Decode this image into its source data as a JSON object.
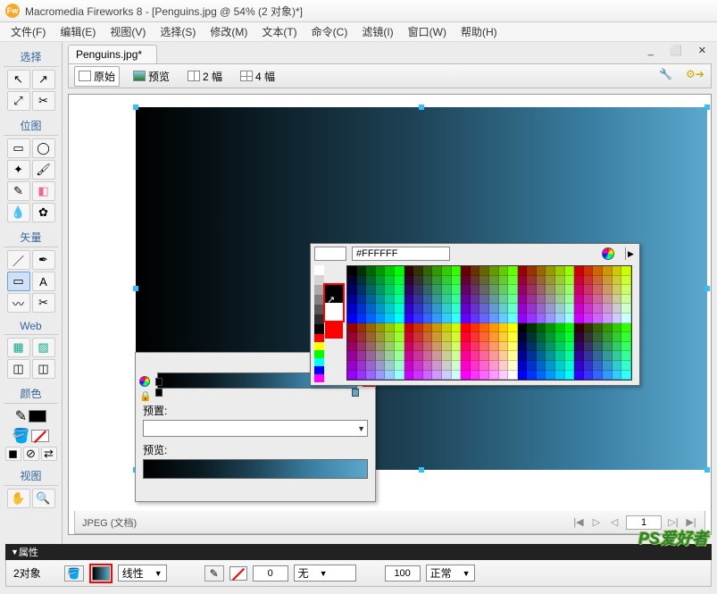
{
  "title": "Macromedia Fireworks 8 - [Penguins.jpg @   54% (2 对象)*]",
  "menu": [
    "文件(F)",
    "编辑(E)",
    "视图(V)",
    "选择(S)",
    "修改(M)",
    "文本(T)",
    "命令(C)",
    "滤镜(I)",
    "窗口(W)",
    "帮助(H)"
  ],
  "tool_groups": {
    "select": "选择",
    "bitmap": "位图",
    "vector": "矢量",
    "web": "Web",
    "colors": "颜色",
    "view": "视图"
  },
  "doc_tab": "Penguins.jpg*",
  "doc_toolbar": {
    "original": "原始",
    "preview": "预览",
    "two": "2 幅",
    "four": "4 幅"
  },
  "status": "JPEG (文档)",
  "page_current": "1",
  "grad_popup": {
    "preset_label": "预置:",
    "preview_label": "预览:"
  },
  "color_popup": {
    "hex": "#FFFFFF"
  },
  "properties": {
    "title": "属性",
    "object_count": "2对象",
    "fill_type": "线性",
    "edge": "0",
    "stroke_type": "无",
    "opacity": "100",
    "blend": "正常"
  },
  "watermark": "PS爱好者"
}
